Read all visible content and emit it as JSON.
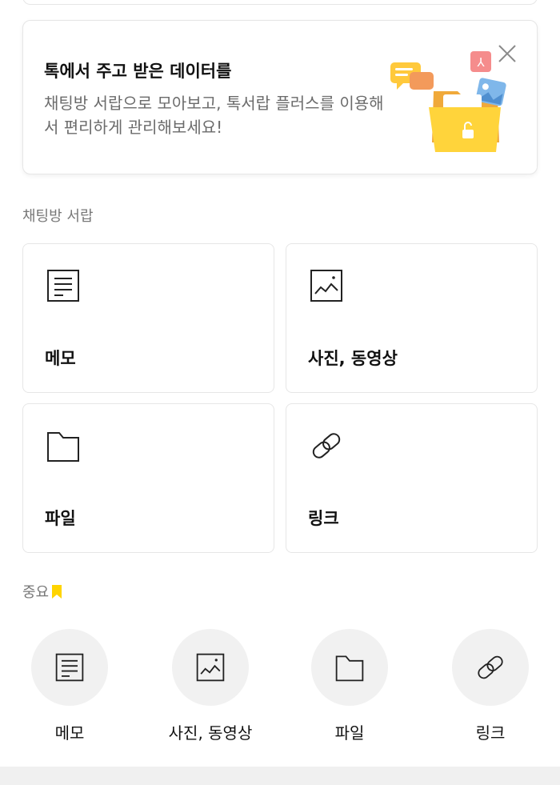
{
  "banner": {
    "title": "톡에서 주고 받은 데이터를",
    "description": "채팅방 서랍으로 모아보고, 톡서랍 플러스를 이용해서 편리하게 관리해보세요!"
  },
  "drawer": {
    "section_label": "채팅방 서랍",
    "cards": [
      {
        "label": "메모",
        "icon": "memo-icon"
      },
      {
        "label": "사진, 동영상",
        "icon": "photo-icon"
      },
      {
        "label": "파일",
        "icon": "folder-icon"
      },
      {
        "label": "링크",
        "icon": "link-icon"
      }
    ]
  },
  "important": {
    "section_label": "중요",
    "items": [
      {
        "label": "메모",
        "icon": "memo-icon"
      },
      {
        "label": "사진, 동영상",
        "icon": "photo-icon"
      },
      {
        "label": "파일",
        "icon": "folder-icon"
      },
      {
        "label": "링크",
        "icon": "link-icon"
      }
    ]
  },
  "colors": {
    "bookmark": "#FFD400",
    "folder": "#FFC93C",
    "card_border": "#E6E6E6",
    "circle_bg": "#F1F1F1"
  }
}
